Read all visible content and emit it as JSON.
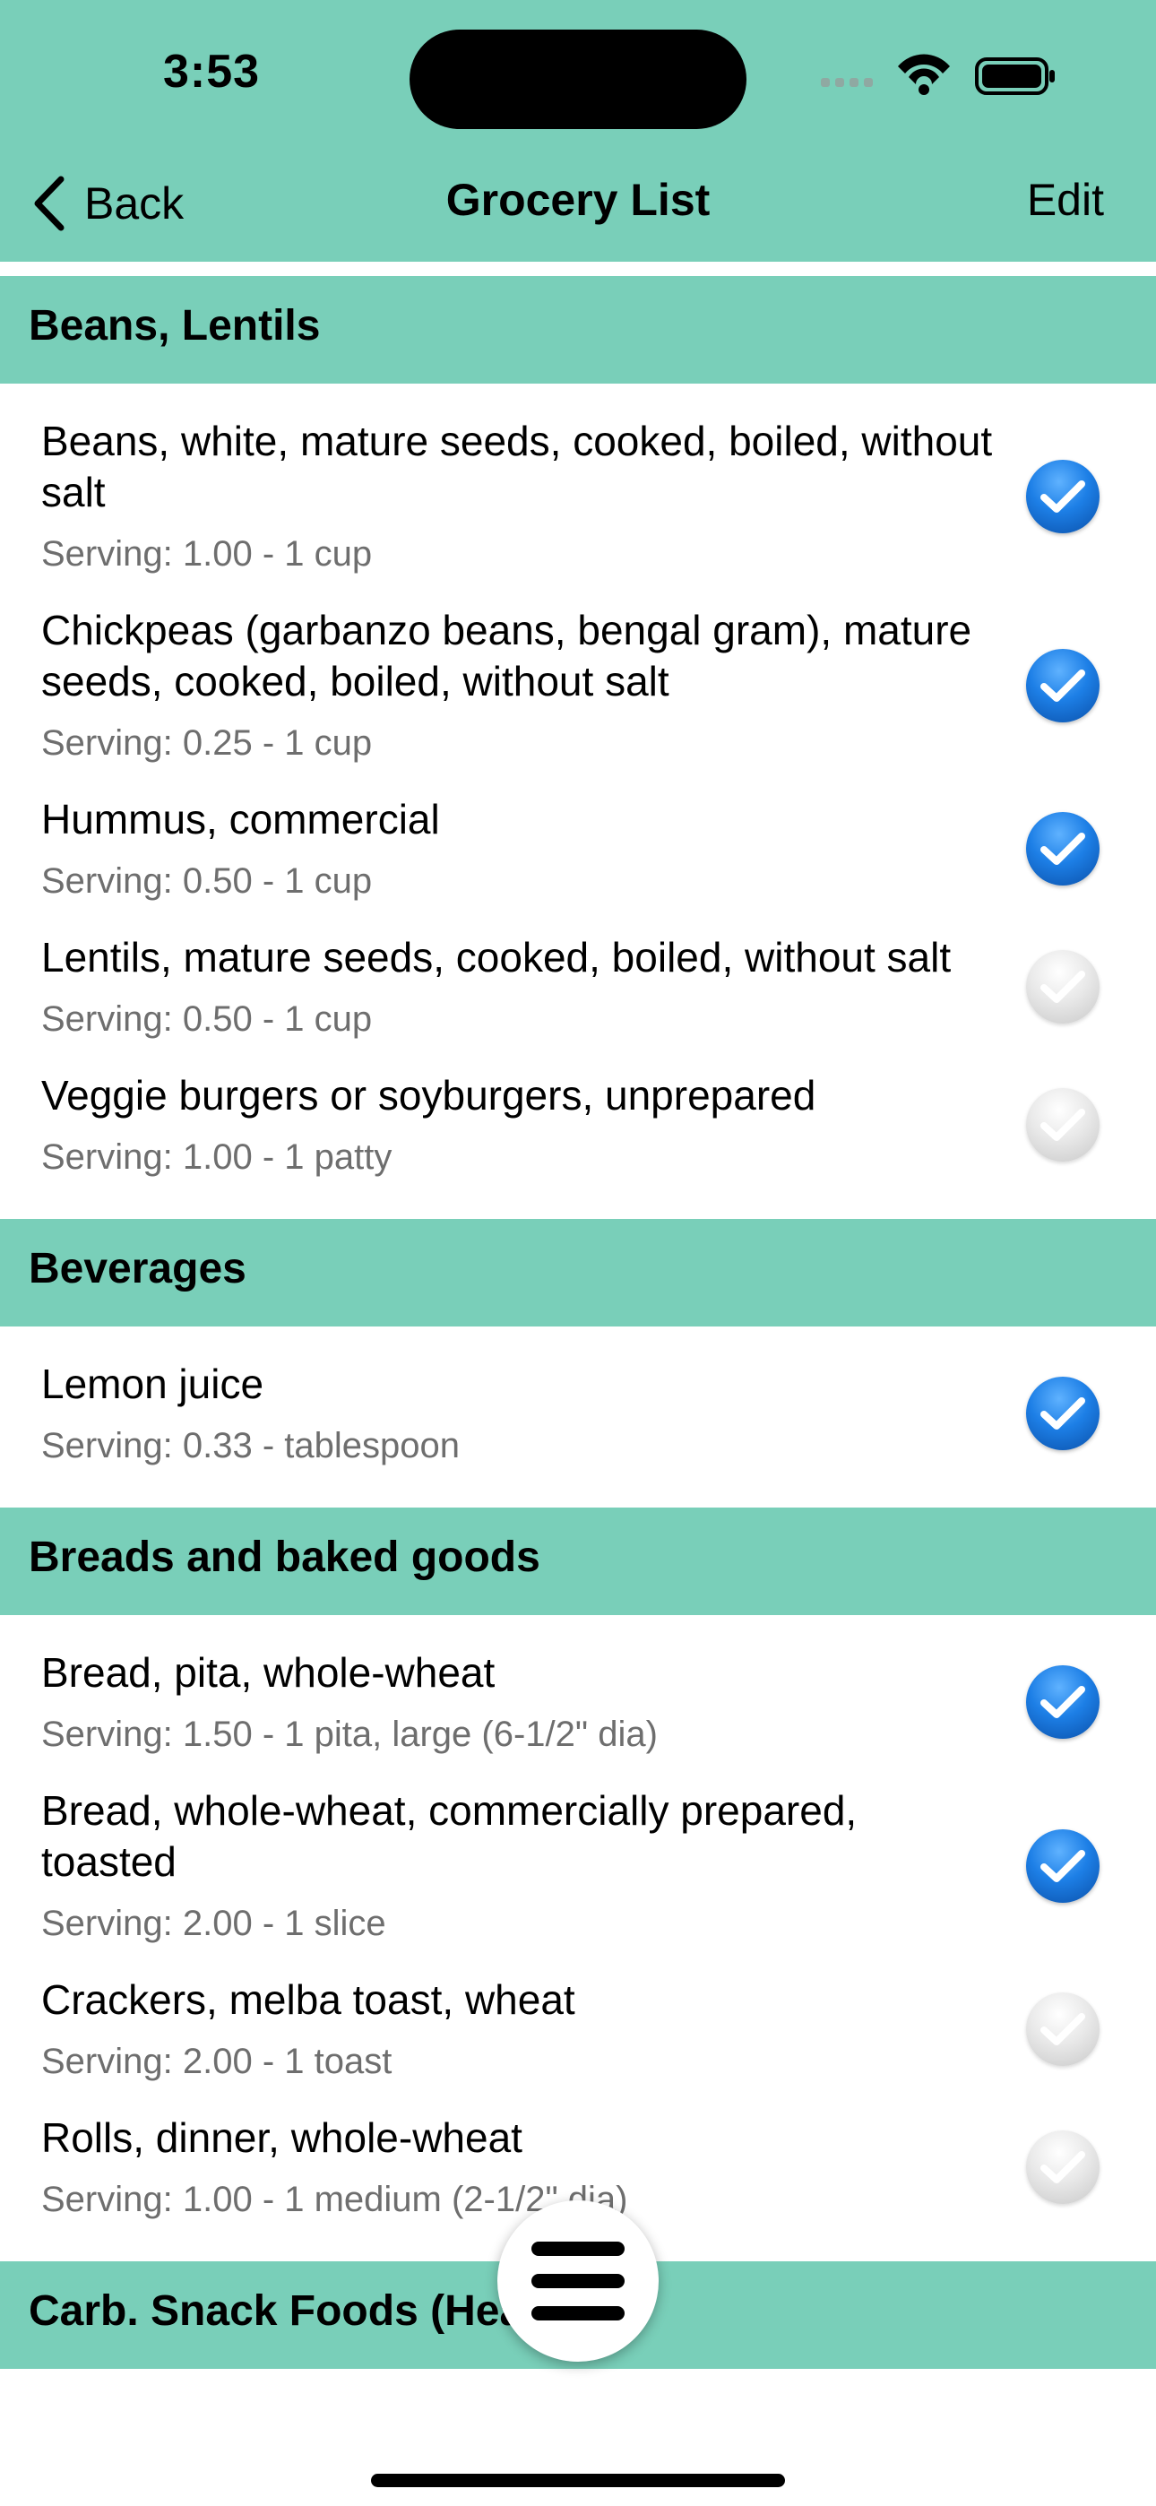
{
  "status_bar": {
    "time": "3:53"
  },
  "nav": {
    "back_label": "Back",
    "title": "Grocery List",
    "edit_label": "Edit"
  },
  "colors": {
    "header_background": "#79cfb9",
    "check_on": "#1d7fe6",
    "check_off": "#d9d9d9",
    "serving_text": "#6e6e6e"
  },
  "sections": [
    {
      "title": "Beans, Lentils",
      "items": [
        {
          "name": "Beans, white, mature seeds, cooked, boiled, without salt",
          "serving": "Serving: 1.00 - 1 cup",
          "checked": true
        },
        {
          "name": "Chickpeas (garbanzo beans, bengal gram), mature seeds, cooked, boiled, without salt",
          "serving": "Serving: 0.25 - 1 cup",
          "checked": true
        },
        {
          "name": "Hummus, commercial",
          "serving": "Serving: 0.50 - 1 cup",
          "checked": true
        },
        {
          "name": "Lentils, mature seeds, cooked, boiled, without salt",
          "serving": "Serving: 0.50 - 1 cup",
          "checked": false
        },
        {
          "name": "Veggie burgers or soyburgers, unprepared",
          "serving": "Serving: 1.00 - 1 patty",
          "checked": false
        }
      ]
    },
    {
      "title": "Beverages",
      "items": [
        {
          "name": "Lemon juice",
          "serving": "Serving: 0.33 - tablespoon",
          "checked": true
        }
      ]
    },
    {
      "title": "Breads and baked goods",
      "items": [
        {
          "name": "Bread, pita, whole-wheat",
          "serving": "Serving: 1.50 - 1 pita, large (6-1/2\" dia)",
          "checked": true
        },
        {
          "name": "Bread, whole-wheat, commercially prepared, toasted",
          "serving": "Serving: 2.00 - 1 slice",
          "checked": true
        },
        {
          "name": "Crackers, melba toast, wheat",
          "serving": "Serving: 2.00 - 1 toast",
          "checked": false
        },
        {
          "name": "Rolls, dinner, whole-wheat",
          "serving": "Serving: 1.00 - 1 medium (2-1/2\" dia)",
          "checked": false
        }
      ]
    },
    {
      "title": "Carb. Snack Foods (Healthy)",
      "items": []
    }
  ],
  "icons": {
    "back": "chevron-left-icon",
    "menu": "hamburger-menu-icon",
    "check": "checkmark-circle-icon",
    "wifi": "wifi-icon",
    "battery": "battery-icon",
    "signal": "cellular-signal-icon"
  }
}
